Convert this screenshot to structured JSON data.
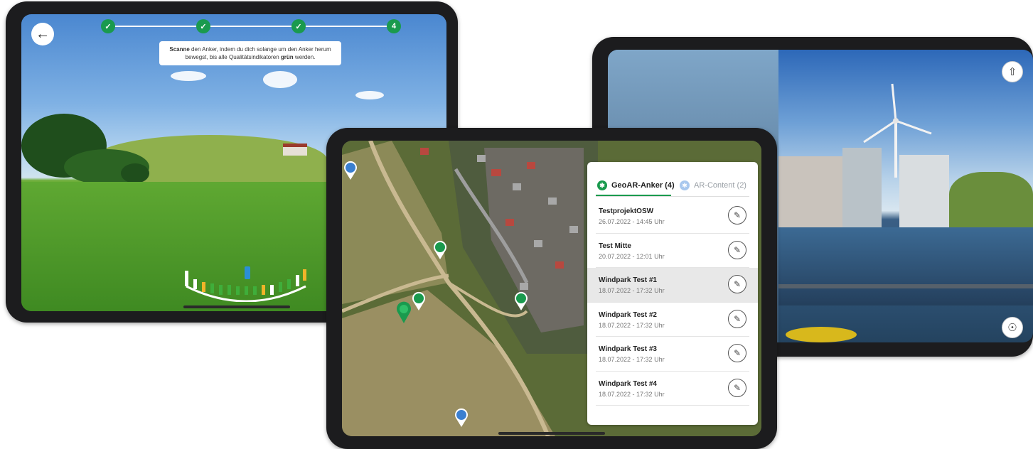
{
  "scan_screen": {
    "back_icon": "arrow-left-icon",
    "steps": [
      {
        "state": "done",
        "label": "✓"
      },
      {
        "state": "done",
        "label": "✓"
      },
      {
        "state": "done",
        "label": "✓"
      },
      {
        "state": "current",
        "label": "4"
      }
    ],
    "instruction": {
      "bold1": "Scanne",
      "text1": " den Anker, indem du dich solange um den Anker herum bewegst, bis alle Qualitätsindikatoren ",
      "bold2": "grün",
      "text2": " werden."
    },
    "colors": {
      "step": "#1a9a4e",
      "good": "#3fae3a",
      "warn": "#f0b429",
      "focus": "#2b8fd6"
    }
  },
  "anchor_list": {
    "tabs": [
      {
        "icon": "geo-anchor-icon",
        "label": "GeoAR-Anker (4)",
        "active": true
      },
      {
        "icon": "ar-content-icon",
        "label": "AR-Content (2)",
        "active": false
      }
    ],
    "items": [
      {
        "title": "TestprojektOSW",
        "date": "26.07.2022 - 14:45 Uhr",
        "selected": false
      },
      {
        "title": "Test Mitte",
        "date": "20.07.2022 - 12:01 Uhr",
        "selected": false
      },
      {
        "title": "Windpark Test #1",
        "date": "18.07.2022 - 17:32 Uhr",
        "selected": true
      },
      {
        "title": "Windpark Test #2",
        "date": "18.07.2022 - 17:32 Uhr",
        "selected": false
      },
      {
        "title": "Windpark Test #3",
        "date": "18.07.2022 - 17:32 Uhr",
        "selected": false
      },
      {
        "title": "Windpark Test #4",
        "date": "18.07.2022 - 17:32 Uhr",
        "selected": false
      }
    ],
    "edit_icon": "pencil-icon",
    "colors": {
      "accent": "#1a9a4e",
      "ar": "#3a7fd0"
    }
  },
  "ar_view": {
    "upload_icon": "cloud-upload-icon",
    "place_icon": "place-anchor-icon"
  }
}
